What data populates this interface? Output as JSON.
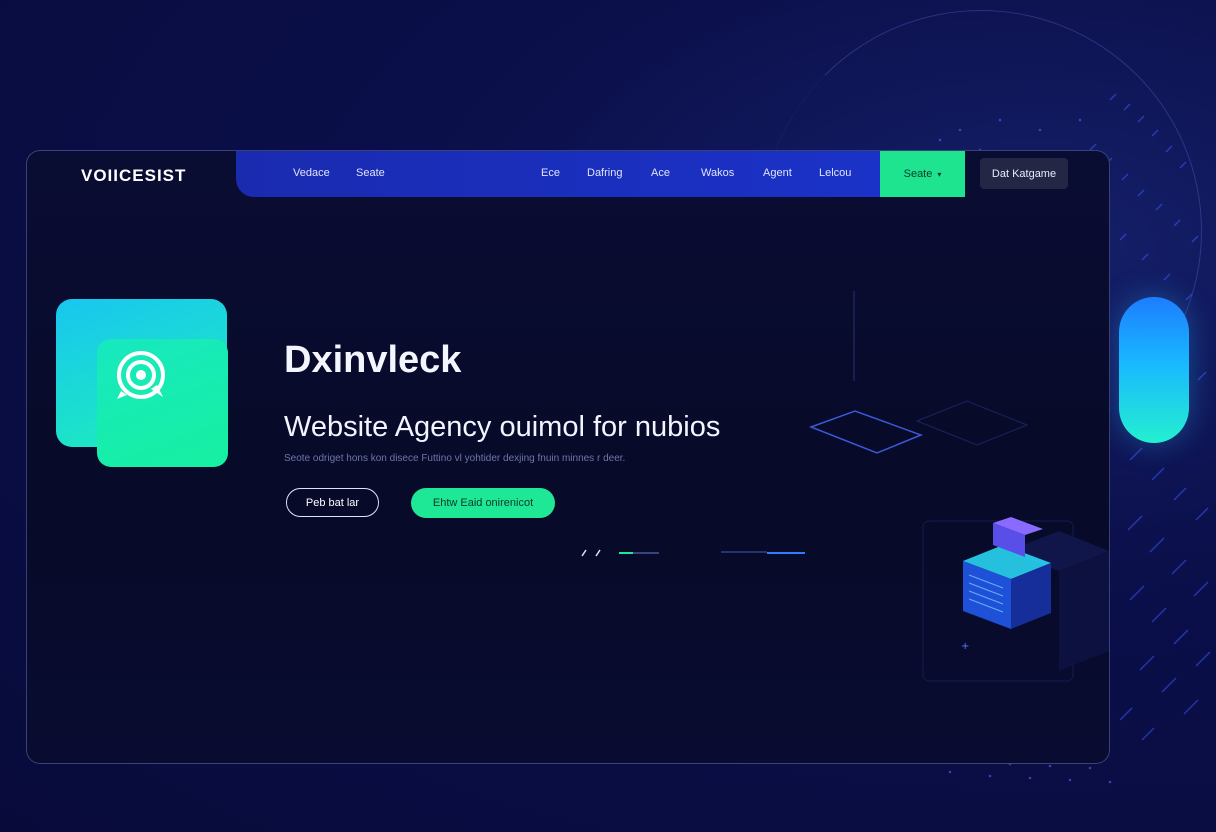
{
  "brand": {
    "name": "VOIICESIST"
  },
  "nav": {
    "left_items": [
      {
        "label": "Vedace"
      },
      {
        "label": "Seate"
      }
    ],
    "right_items": [
      {
        "label": "Ece"
      },
      {
        "label": "Dafring"
      },
      {
        "label": "Ace"
      },
      {
        "label": "Wakos"
      },
      {
        "label": "Agent"
      },
      {
        "label": "Lelcou"
      }
    ],
    "cta_label": "Seate",
    "cta_icon": "chevron-down-icon",
    "secondary_label": "Dat Katgame"
  },
  "hero": {
    "title": "Dxinvleck",
    "subtitle": "Website Agency ouimol for nubios",
    "description": "Seote odriget hons kon disece Futtino vl yohtider dexjing fnuin minnes r deer.",
    "primary_button": "Peb bat lar",
    "secondary_button": "Ehtw Eaid onirenicot"
  },
  "colors": {
    "accent_green": "#1ee896",
    "nav_blue": "#1b2fc0",
    "background": "#0a0d3a",
    "cyan": "#19c6f0"
  }
}
